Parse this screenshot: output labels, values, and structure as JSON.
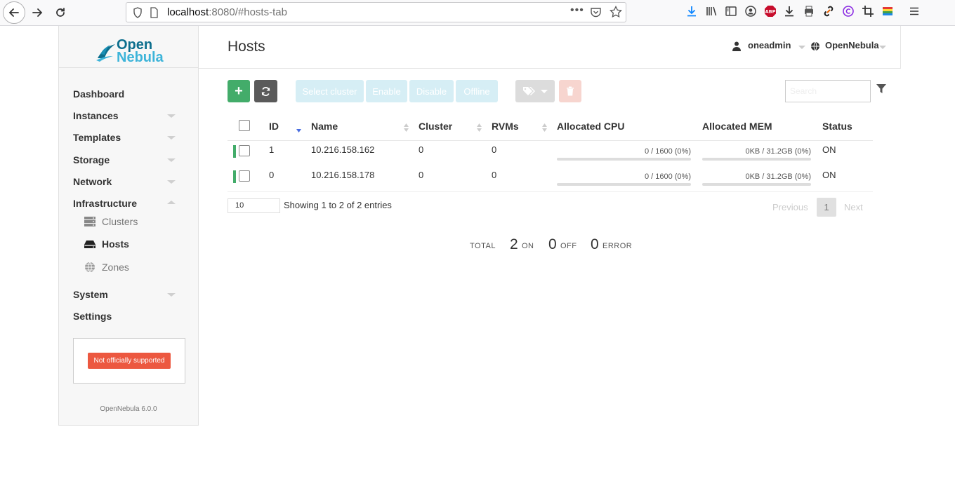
{
  "browser": {
    "url_host": "localhost",
    "url_rest": ":8080/#hosts-tab",
    "more_label": "•••"
  },
  "sidebar": {
    "logo_line1": "Open",
    "logo_line2": "Nebula",
    "items": [
      {
        "label": "Dashboard"
      },
      {
        "label": "Instances"
      },
      {
        "label": "Templates"
      },
      {
        "label": "Storage"
      },
      {
        "label": "Network"
      },
      {
        "label": "Infrastructure"
      }
    ],
    "sub_items": [
      {
        "label": "Clusters"
      },
      {
        "label": "Hosts"
      },
      {
        "label": "Zones"
      }
    ],
    "items_after": [
      {
        "label": "System"
      },
      {
        "label": "Settings"
      }
    ],
    "support_badge": "Not officially supported",
    "version": "OpenNebula 6.0.0"
  },
  "header": {
    "title": "Hosts",
    "user": "oneadmin",
    "zone": "OpenNebula"
  },
  "actions": {
    "add": "+",
    "select_cluster": "Select cluster",
    "enable": "Enable",
    "disable": "Disable",
    "offline": "Offline",
    "search_placeholder": "Search"
  },
  "table": {
    "columns": [
      "ID",
      "Name",
      "Cluster",
      "RVMs",
      "Allocated CPU",
      "Allocated MEM",
      "Status"
    ],
    "rows": [
      {
        "id": "1",
        "name": "10.216.158.162",
        "cluster": "0",
        "rvms": "0",
        "cpu": "0 / 1600 (0%)",
        "cpu_pct": 0,
        "mem": "0KB / 31.2GB (0%)",
        "mem_pct": 0,
        "status": "ON"
      },
      {
        "id": "0",
        "name": "10.216.158.178",
        "cluster": "0",
        "rvms": "0",
        "cpu": "0 / 1600 (0%)",
        "cpu_pct": 0,
        "mem": "0KB / 31.2GB (0%)",
        "mem_pct": 0,
        "status": "ON"
      }
    ],
    "page_length": "10",
    "showing": "Showing 1 to 2 of 2 entries",
    "previous": "Previous",
    "current_page": "1",
    "next": "Next"
  },
  "totals": {
    "total_label": "TOTAL",
    "on_count": "2",
    "on_label": "ON",
    "off_count": "0",
    "off_label": "OFF",
    "error_count": "0",
    "error_label": "ERROR"
  },
  "colors": {
    "add_button": "#43ac6a",
    "refresh_button": "#5a5a5a",
    "status_on": "#43ac6a",
    "support_badge": "#ec5840"
  }
}
